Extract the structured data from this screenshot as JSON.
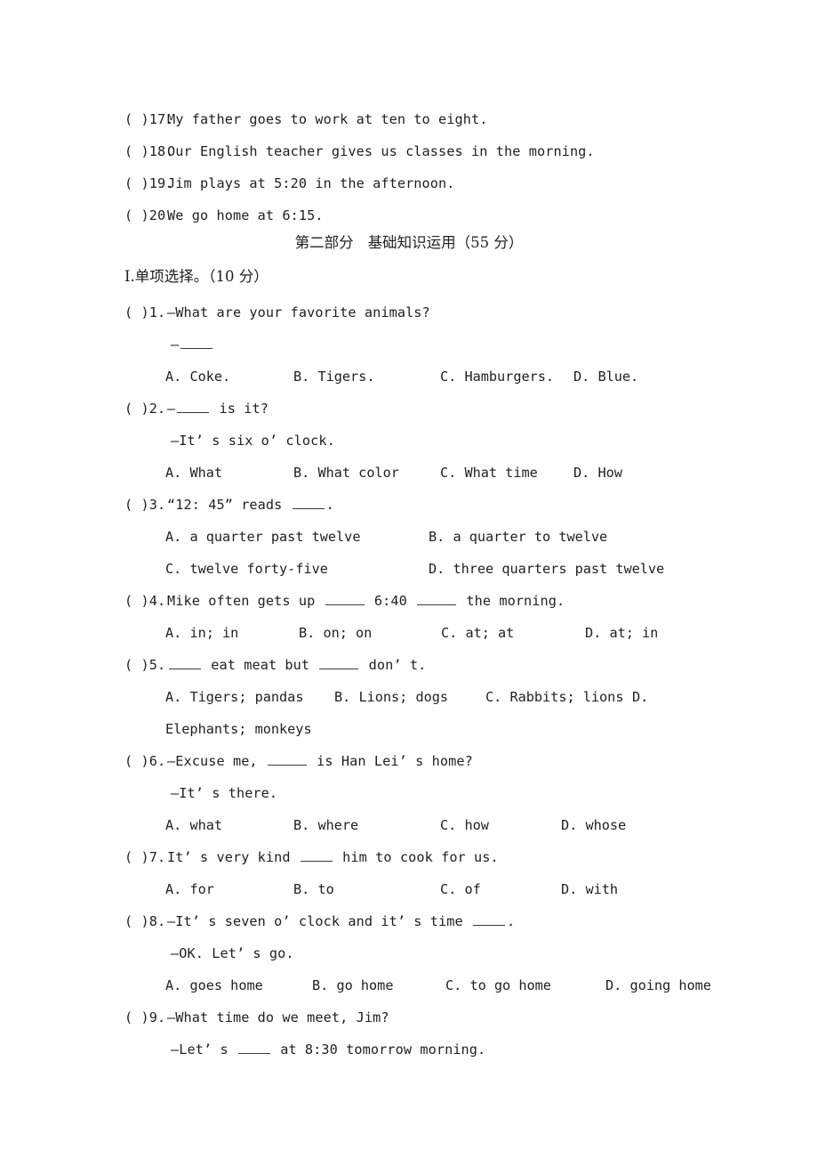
{
  "document": {
    "type": "exam-paper",
    "language": "en-zh",
    "listening_items": [
      {
        "marker": "(    )17.",
        "text": "My father goes to work at ten to eight."
      },
      {
        "marker": "(    )18.",
        "text": "Our English teacher gives us classes in the morning."
      },
      {
        "marker": "(    )19.",
        "text": "Jim plays at 5:20 in the afternoon."
      },
      {
        "marker": "(    )20.",
        "text": "We go home at 6:15."
      }
    ],
    "section_title": {
      "part": "第二部分",
      "name": "基础知识运用",
      "points": "（55 分）"
    },
    "part_heading": {
      "roman": "Ⅰ",
      "text": ".单项选择。",
      "points": "（10 分）"
    },
    "questions": [
      {
        "marker": "(    )1.",
        "stem_before": "—What are your favorite animals?",
        "reply": "—",
        "reply_has_blank": true,
        "options": [
          {
            "letter": "A.",
            "text": "Coke."
          },
          {
            "letter": "B.",
            "text": "Tigers."
          },
          {
            "letter": "C.",
            "text": "Hamburgers."
          },
          {
            "letter": "D.",
            "text": "Blue."
          }
        ]
      },
      {
        "marker": "(    )2.",
        "stem_before": "—",
        "stem_after": " is it?",
        "reply": "—It’ s six o’ clock.",
        "options": [
          {
            "letter": "A.",
            "text": "What"
          },
          {
            "letter": "B.",
            "text": "What color"
          },
          {
            "letter": "C.",
            "text": "What time"
          },
          {
            "letter": "D.",
            "text": "How"
          }
        ]
      },
      {
        "marker": "(    )3.",
        "stem_before": "“12: 45” reads ",
        "stem_after": ".",
        "options": [
          {
            "letter": "A.",
            "text": "a quarter past twelve"
          },
          {
            "letter": "B.",
            "text": "a quarter to twelve"
          },
          {
            "letter": "C.",
            "text": "twelve forty-five"
          },
          {
            "letter": "D.",
            "text": "three quarters past twelve"
          }
        ]
      },
      {
        "marker": "(    )4.",
        "stem_before": "Mike often gets up ",
        "stem_mid": " 6:40 ",
        "stem_after": " the morning.",
        "options": [
          {
            "letter": "A.",
            "text": "in; in"
          },
          {
            "letter": "B.",
            "text": "on; on"
          },
          {
            "letter": "C.",
            "text": "at; at"
          },
          {
            "letter": "D.",
            "text": "at; in"
          }
        ]
      },
      {
        "marker": "(    )5.",
        "stem_before": "",
        "stem_mid": " eat meat but ",
        "stem_after": " don’ t.",
        "options": [
          {
            "letter": "A.",
            "text": "Tigers; pandas"
          },
          {
            "letter": "B.",
            "text": "Lions; dogs"
          },
          {
            "letter": "C.",
            "text": "Rabbits; lions"
          },
          {
            "letter": "D.",
            "text": "Elephants; monkeys"
          }
        ]
      },
      {
        "marker": "(    )6.",
        "stem_before": "—Excuse me, ",
        "stem_after": " is Han Lei’ s home?",
        "reply": "—It’ s there.",
        "options": [
          {
            "letter": "A.",
            "text": "what"
          },
          {
            "letter": "B.",
            "text": "where"
          },
          {
            "letter": "C.",
            "text": "how"
          },
          {
            "letter": "D.",
            "text": "whose"
          }
        ]
      },
      {
        "marker": "(    )7.",
        "stem_before": "It’ s very kind ",
        "stem_after": " him to cook for us.",
        "options": [
          {
            "letter": "A.",
            "text": "for"
          },
          {
            "letter": "B.",
            "text": "to"
          },
          {
            "letter": "C.",
            "text": "of"
          },
          {
            "letter": "D.",
            "text": "with"
          }
        ]
      },
      {
        "marker": "(    )8.",
        "stem_before": "—It’ s seven o’ clock and it’ s time ",
        "stem_after": ".",
        "reply": "—OK. Let’ s go.",
        "options": [
          {
            "letter": "A.",
            "text": "goes home"
          },
          {
            "letter": "B.",
            "text": "go home"
          },
          {
            "letter": "C.",
            "text": "to go home"
          },
          {
            "letter": "D.",
            "text": "going home"
          }
        ]
      },
      {
        "marker": "(    )9.",
        "stem_before": "—What time do we meet, Jim?",
        "reply_before": "—Let’ s ",
        "reply_after": " at 8:30 tomorrow morning."
      }
    ]
  }
}
